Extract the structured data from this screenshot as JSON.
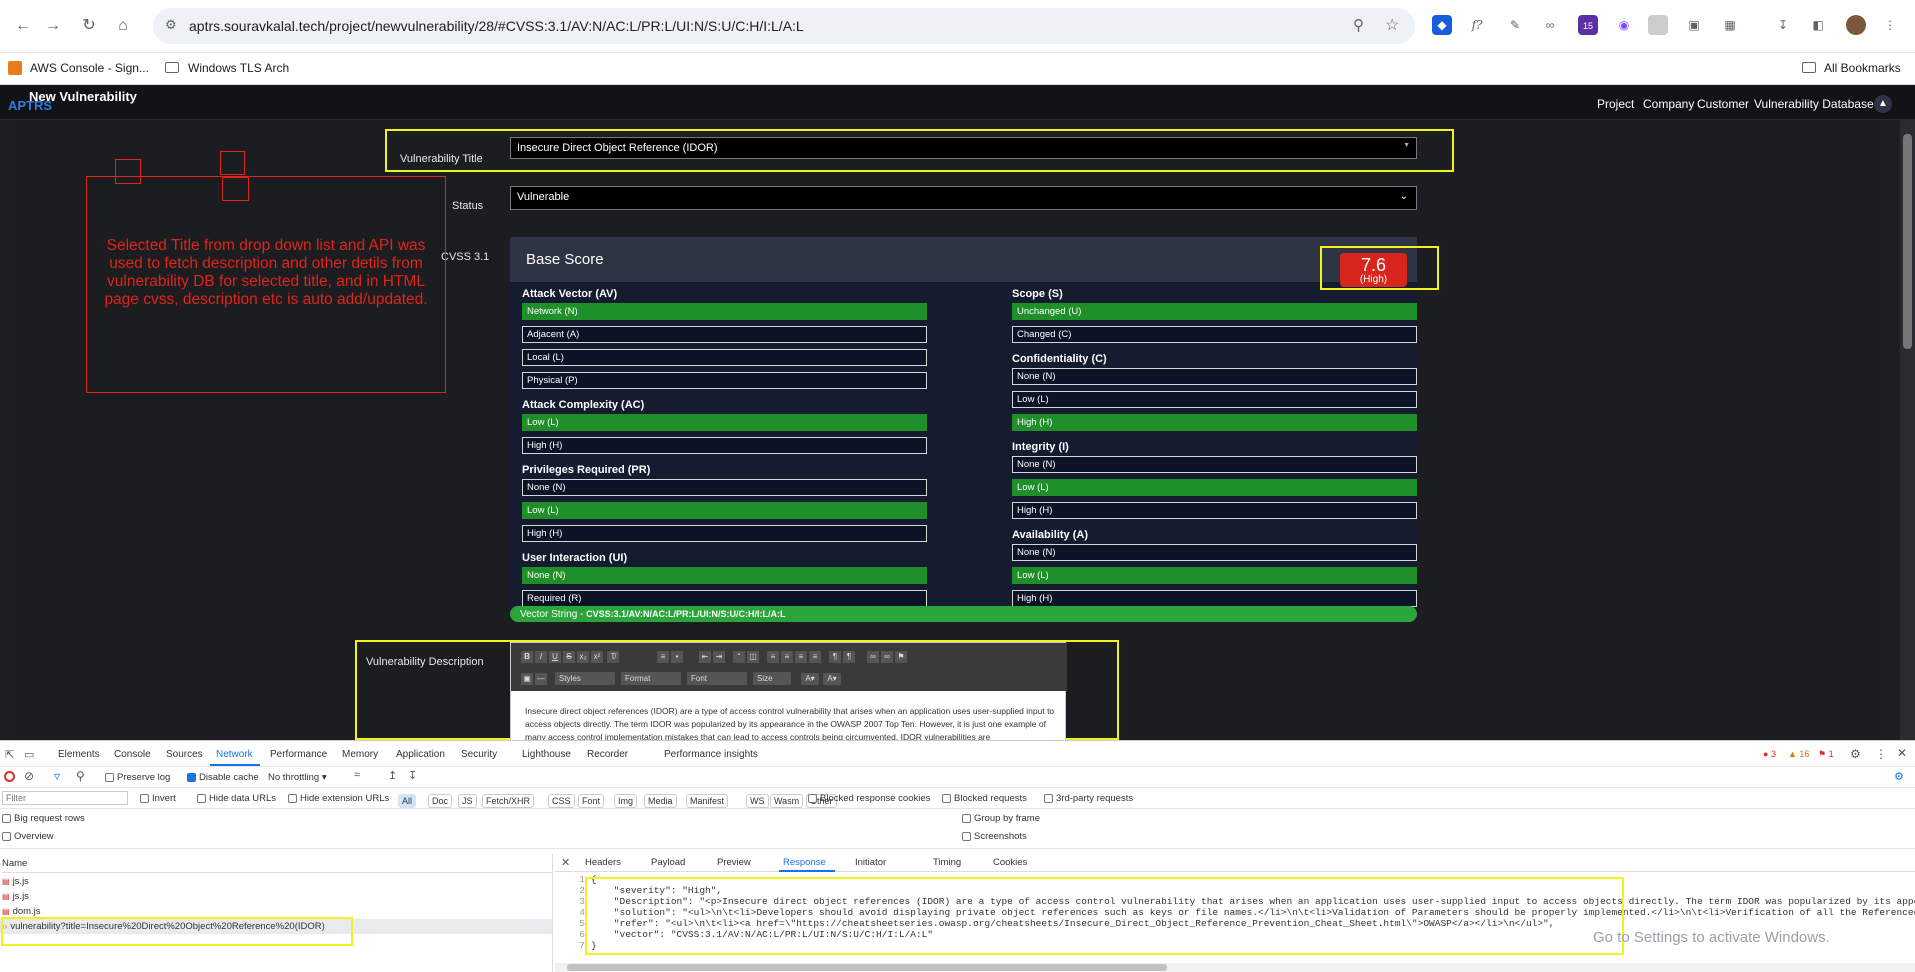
{
  "browser": {
    "url": "aptrs.souravkalal.tech/project/newvulnerability/28/#CVSS:3.1/AV:N/AC:L/PR:L/UI:N/S:U/C:H/I:L/A:L",
    "extension_badge": "15",
    "bookmarks": [
      "AWS Console - Sign...",
      "Windows TLS Arch"
    ],
    "all_bookmarks": "All Bookmarks"
  },
  "app": {
    "logo": "APTRS",
    "page_title": "New Vulnerability",
    "nav": [
      "Project",
      "Company",
      "Customer",
      "Vulnerability Database"
    ],
    "form": {
      "title_label": "Vulnerability Title",
      "title_value": "Insecure Direct Object Reference (IDOR)",
      "status_label": "Status",
      "status_value": "Vulnerable",
      "cvss_label": "CVSS 3.1",
      "description_label": "Vulnerability Description"
    },
    "annotation": "Selected Title from drop down list and API was used to fetch description and other detils from vulnerability DB for selected title, and in HTML page cvss, description etc is auto add/updated.",
    "cvss": {
      "base_score_label": "Base Score",
      "score": "7.6",
      "severity": "(High)",
      "score_color": "#d9261c",
      "left_metrics": [
        {
          "title": "Attack Vector (AV)",
          "options": [
            "Network (N)",
            "Adjacent (A)",
            "Local (L)",
            "Physical (P)"
          ],
          "selected": 0
        },
        {
          "title": "Attack Complexity (AC)",
          "options": [
            "Low (L)",
            "High (H)"
          ],
          "selected": 0
        },
        {
          "title": "Privileges Required (PR)",
          "options": [
            "None (N)",
            "Low (L)",
            "High (H)"
          ],
          "selected": 1
        },
        {
          "title": "User Interaction (UI)",
          "options": [
            "None (N)",
            "Required (R)"
          ],
          "selected": 0
        }
      ],
      "right_metrics": [
        {
          "title": "Scope (S)",
          "options": [
            "Unchanged (U)",
            "Changed (C)"
          ],
          "selected": 0
        },
        {
          "title": "Confidentiality (C)",
          "options": [
            "None (N)",
            "Low (L)",
            "High (H)"
          ],
          "selected": 2
        },
        {
          "title": "Integrity (I)",
          "options": [
            "None (N)",
            "Low (L)",
            "High (H)"
          ],
          "selected": 1
        },
        {
          "title": "Availability (A)",
          "options": [
            "None (N)",
            "Low (L)",
            "High (H)"
          ],
          "selected": 1
        }
      ],
      "vector_label": "Vector String - ",
      "vector_value": "CVSS:3.1/AV:N/AC:L/PR:L/UI:N/S:U/C:H/I:L/A:L"
    },
    "editor": {
      "dropdowns": [
        "Styles",
        "Format",
        "Font",
        "Size"
      ],
      "text": "Insecure direct object references (IDOR) are a type of access control vulnerability that arises when an application uses user-supplied input to access objects directly. The term IDOR was popularized by its appearance in the OWASP 2007 Top Ten. However, it is just one example of many access control implementation mistakes that can lead to access controls being circumvented. IDOR vulnerabilities are"
    }
  },
  "devtools": {
    "tabs": [
      "Elements",
      "Console",
      "Sources",
      "Network",
      "Performance",
      "Memory",
      "Application",
      "Security",
      "Lighthouse",
      "Recorder",
      "Performance insights"
    ],
    "active_tab": "Network",
    "counts": {
      "errors": "3",
      "warnings": "16",
      "issues": "1"
    },
    "toolbar": {
      "preserve_log": "Preserve log",
      "disable_cache": "Disable cache",
      "throttling": "No throttling"
    },
    "filter_placeholder": "Filter",
    "filter_options": [
      "Invert",
      "Hide data URLs",
      "Hide extension URLs"
    ],
    "type_filters": [
      "All",
      "Doc",
      "JS",
      "Fetch/XHR",
      "CSS",
      "Font",
      "Img",
      "Media",
      "Manifest",
      "WS",
      "Wasm",
      "Other"
    ],
    "extra_filters": [
      "Blocked response cookies",
      "Blocked requests",
      "3rd-party requests"
    ],
    "settings": {
      "big_rows": "Big request rows",
      "overview": "Overview",
      "group_frame": "Group by frame",
      "screenshots": "Screenshots"
    },
    "name_header": "Name",
    "requests": [
      "js.js",
      "js.js",
      "dom.js",
      "vulnerability?title=Insecure%20Direct%20Object%20Reference%20(IDOR)"
    ],
    "detail_tabs": [
      "Headers",
      "Payload",
      "Preview",
      "Response",
      "Initiator",
      "Timing",
      "Cookies"
    ],
    "active_detail": "Response",
    "response_lines": [
      "{",
      "    \"severity\": \"High\",",
      "    \"Description\": \"<p>Insecure direct object references (IDOR) are a type of access control vulnerability that arises when an application uses user-supplied input to access objects directly. The term IDOR was popularized by its appearance in the",
      "    \"solution\": \"<ul>\\n\\t<li>Developers should avoid displaying private object references such as keys or file names.</li>\\n\\t<li>Validation of Parameters should be properly implemented.</li>\\n\\t<li>Verification of all the Referenced objects sho",
      "    \"refer\": \"<ul>\\n\\t<li><a href=\\\"https://cheatsheetseries.owasp.org/cheatsheets/Insecure_Direct_Object_Reference_Prevention_Cheat_Sheet.html\\\">OWASP</a></li>\\n</ul>\",",
      "    \"vector\": \"CVSS:3.1/AV:N/AC:L/PR:L/UI:N/S:U/C:H/I:L/A:L\"",
      "}"
    ],
    "line_numbers": [
      "1",
      "2",
      "3",
      "4",
      "5",
      "6",
      "7"
    ],
    "watermark": "Go to Settings to activate Windows."
  }
}
